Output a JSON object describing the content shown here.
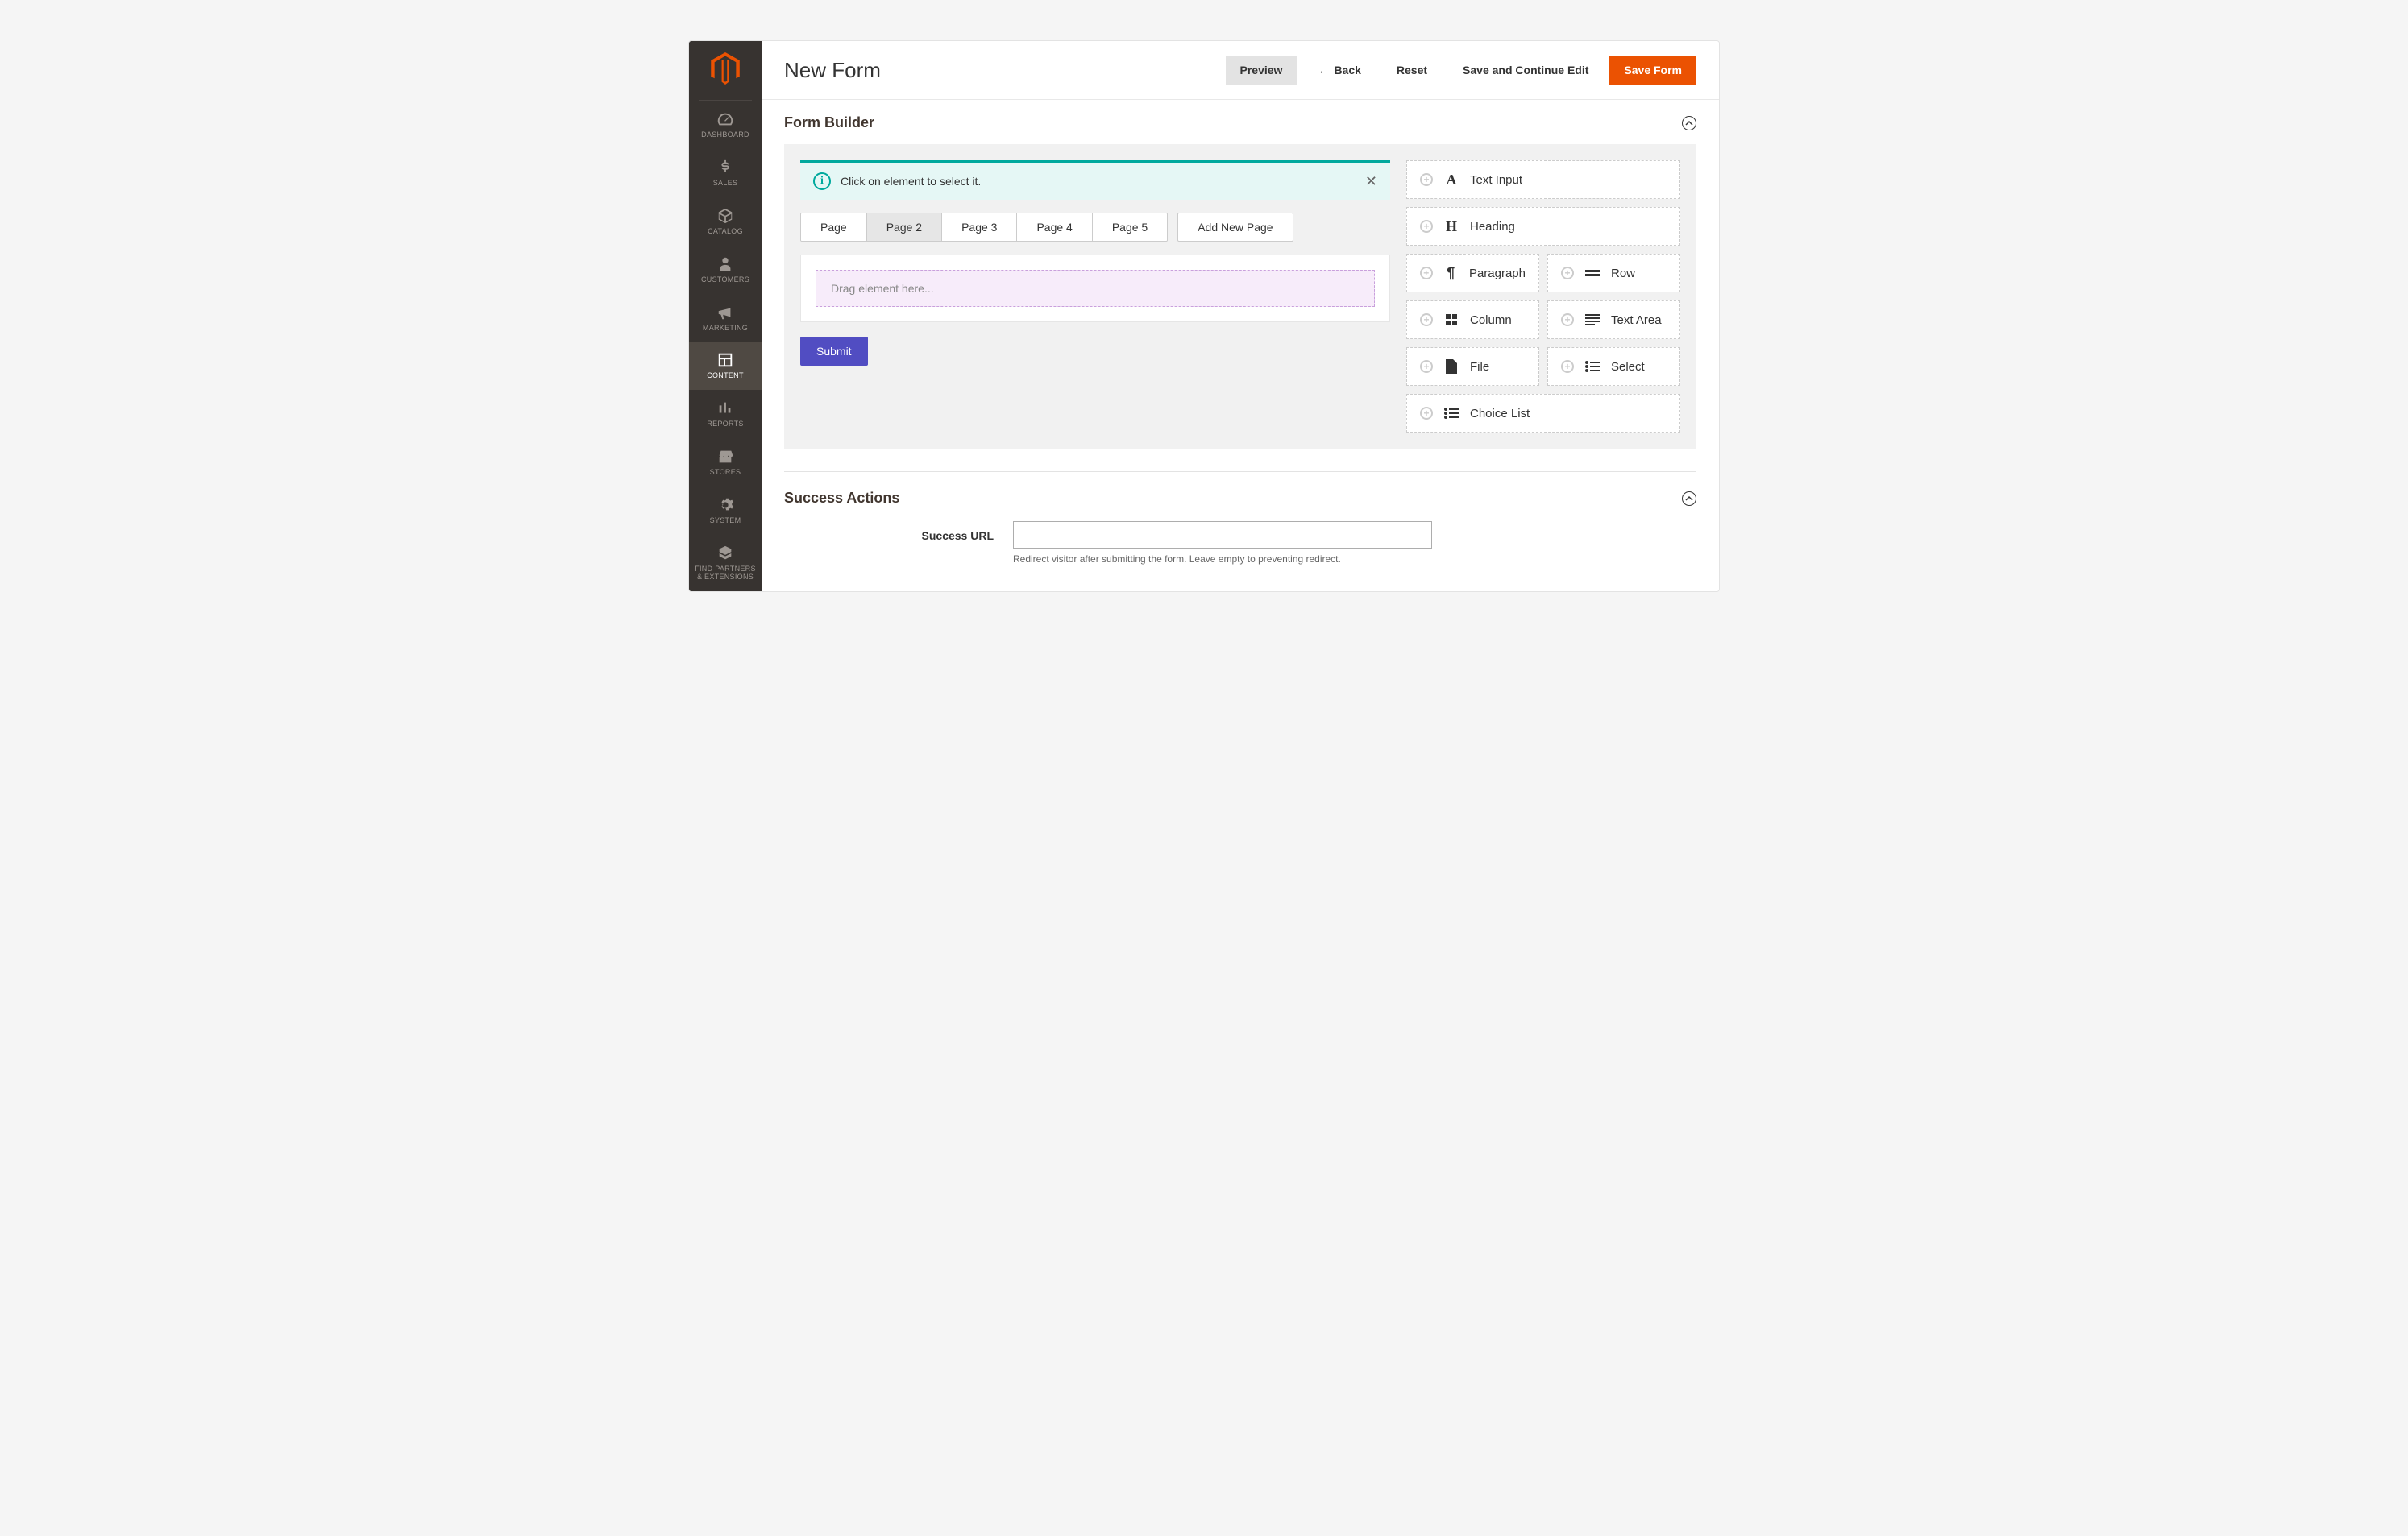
{
  "sidebar": {
    "items": [
      {
        "label": "DASHBOARD"
      },
      {
        "label": "SALES"
      },
      {
        "label": "CATALOG"
      },
      {
        "label": "CUSTOMERS"
      },
      {
        "label": "MARKETING"
      },
      {
        "label": "CONTENT"
      },
      {
        "label": "REPORTS"
      },
      {
        "label": "STORES"
      },
      {
        "label": "SYSTEM"
      },
      {
        "label": "FIND PARTNERS & EXTENSIONS"
      }
    ]
  },
  "header": {
    "title": "New Form",
    "buttons": {
      "preview": "Preview",
      "back": "Back",
      "reset": "Reset",
      "save_continue": "Save and Continue Edit",
      "save": "Save Form"
    }
  },
  "form_builder": {
    "title": "Form Builder",
    "info": "Click on element to select it.",
    "tabs": [
      "Page",
      "Page 2",
      "Page 3",
      "Page 4",
      "Page 5"
    ],
    "active_tab": "Page 2",
    "add_page": "Add New Page",
    "dropzone": "Drag element here...",
    "submit": "Submit",
    "elements": [
      {
        "label": "Text Input",
        "icon": "A",
        "width": "full"
      },
      {
        "label": "Heading",
        "icon": "H",
        "width": "full"
      },
      {
        "label": "Paragraph",
        "icon": "¶",
        "width": "half"
      },
      {
        "label": "Row",
        "icon": "═",
        "width": "half"
      },
      {
        "label": "Column",
        "icon": "▦",
        "width": "half"
      },
      {
        "label": "Text Area",
        "icon": "≡",
        "width": "half"
      },
      {
        "label": "File",
        "icon": "▮",
        "width": "half"
      },
      {
        "label": "Select",
        "icon": "☰",
        "width": "half"
      },
      {
        "label": "Choice List",
        "icon": "☰",
        "width": "full"
      }
    ]
  },
  "success": {
    "title": "Success Actions",
    "url_label": "Success URL",
    "url_value": "",
    "hint": "Redirect visitor after submitting the form. Leave empty to preventing redirect."
  }
}
